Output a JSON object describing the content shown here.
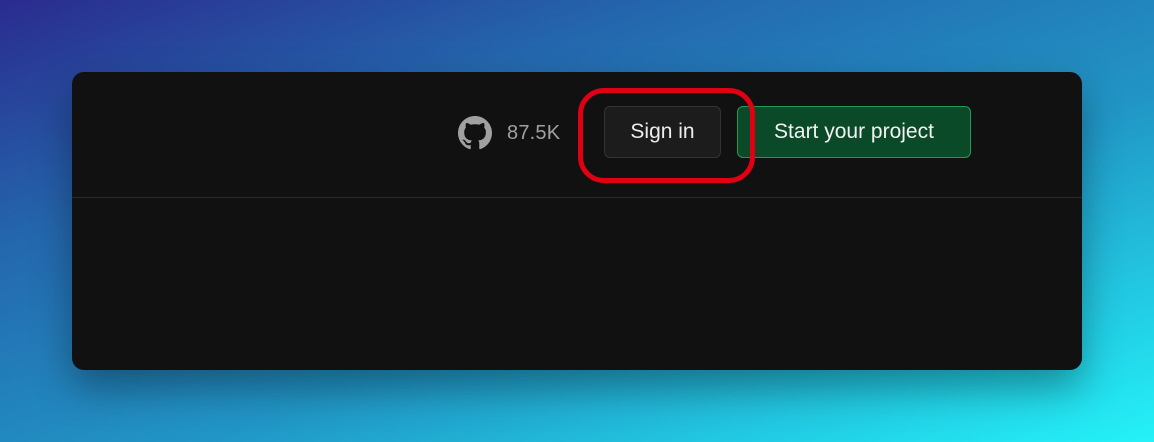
{
  "navbar": {
    "github": {
      "icon": "github-icon",
      "stars": "87.5K"
    },
    "signin_label": "Sign in",
    "start_label": "Start your project"
  },
  "colors": {
    "window_bg": "#111111",
    "primary_button_bg": "#0b4a28",
    "primary_button_border": "#1f9a55",
    "annotation_ring": "#e00012"
  },
  "annotation": {
    "target": "signin-button",
    "style": "red-rounded-ring"
  }
}
